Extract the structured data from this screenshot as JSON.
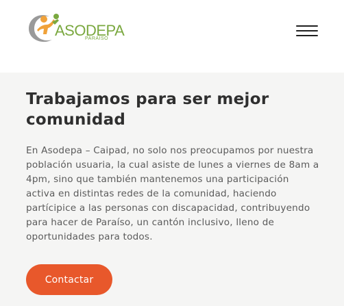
{
  "header": {
    "logo": {
      "name": "ASODEPA",
      "subtitle": "PARAISO",
      "colors": {
        "green": "#7aa83f",
        "orange": "#f0a23a",
        "gray": "#9a9a9a"
      }
    },
    "menu_icon": "hamburger-icon"
  },
  "main": {
    "headline": "Trabajamos para ser mejor comunidad",
    "body": "En Asodepa – Caipad, no solo nos preocupamos por nuestra población usuaria, la cual asiste de lunes a viernes de 8am a 4pm, sino que también mantenemos una participación activa en distintas redes de la comunidad, haciendo partícipice a las personas con discapacidad, contribuyendo para hacer de Paraíso, un cantón inclusivo, lleno de oportunidades para todos.",
    "cta_label": "Contactar"
  },
  "colors": {
    "accent": "#e8582b",
    "headline": "#2f2f2f",
    "background": "#f5f5f4"
  }
}
